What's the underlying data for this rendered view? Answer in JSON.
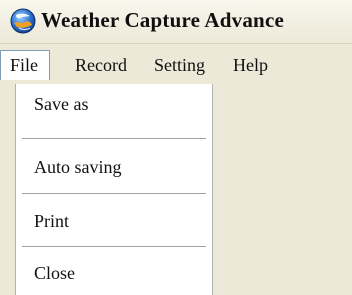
{
  "window": {
    "title": "Weather Capture Advance",
    "icon": "weather-globe-icon"
  },
  "menubar": {
    "items": [
      {
        "label": "File",
        "active": true
      },
      {
        "label": "Record"
      },
      {
        "label": "Setting"
      },
      {
        "label": "Help"
      }
    ]
  },
  "file_menu": {
    "items": [
      {
        "label": "Save as"
      },
      {
        "label": "Auto saving"
      },
      {
        "label": "Print"
      },
      {
        "label": "Close"
      }
    ]
  },
  "colors": {
    "window_bg": "#ece9d8",
    "menu_bg": "#ffffff",
    "icon_blue": "#2a6fd0",
    "icon_orange": "#f0a020"
  }
}
